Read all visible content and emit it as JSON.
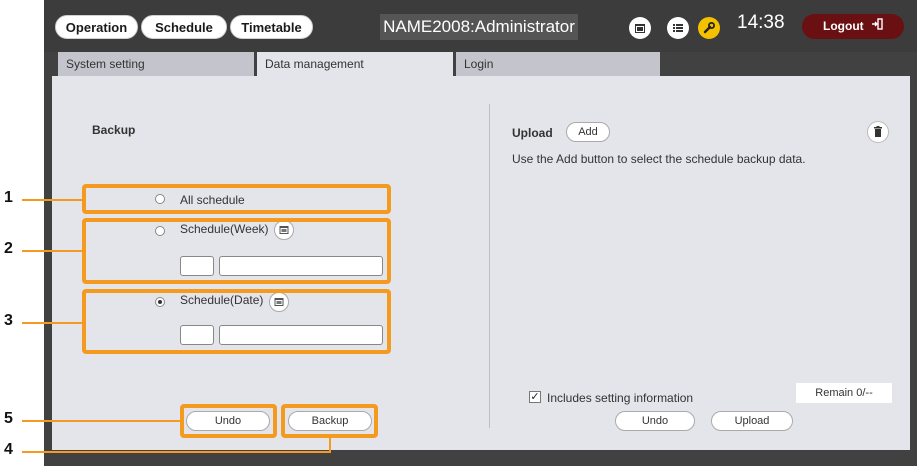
{
  "header": {
    "nav": [
      "Operation",
      "Schedule",
      "Timetable"
    ],
    "user": "NAME2008:Administrator",
    "time": "14:38",
    "logout": "Logout",
    "icons": [
      "calendar-icon",
      "list-icon",
      "wrench-icon",
      "logout-door-icon"
    ]
  },
  "tabs": [
    "System setting",
    "Data management",
    "Login"
  ],
  "active_tab": "Data management",
  "backup": {
    "title": "Backup",
    "options": [
      "All schedule",
      "Schedule(Week)",
      "Schedule(Date)"
    ],
    "selected": "Schedule(Date)",
    "undo_label": "Undo",
    "backup_label": "Backup"
  },
  "upload": {
    "title": "Upload",
    "add_label": "Add",
    "hint": "Use the Add button to select the schedule backup data.",
    "includes_label": "Includes setting information",
    "includes_checked": true,
    "remain": "Remain 0/--",
    "undo_label": "Undo",
    "upload_label": "Upload"
  },
  "callouts": [
    "1",
    "2",
    "3",
    "4",
    "5"
  ],
  "colors": {
    "accent": "#f39a1f",
    "logout": "#6a0f12",
    "panel": "#e4e4eb"
  }
}
